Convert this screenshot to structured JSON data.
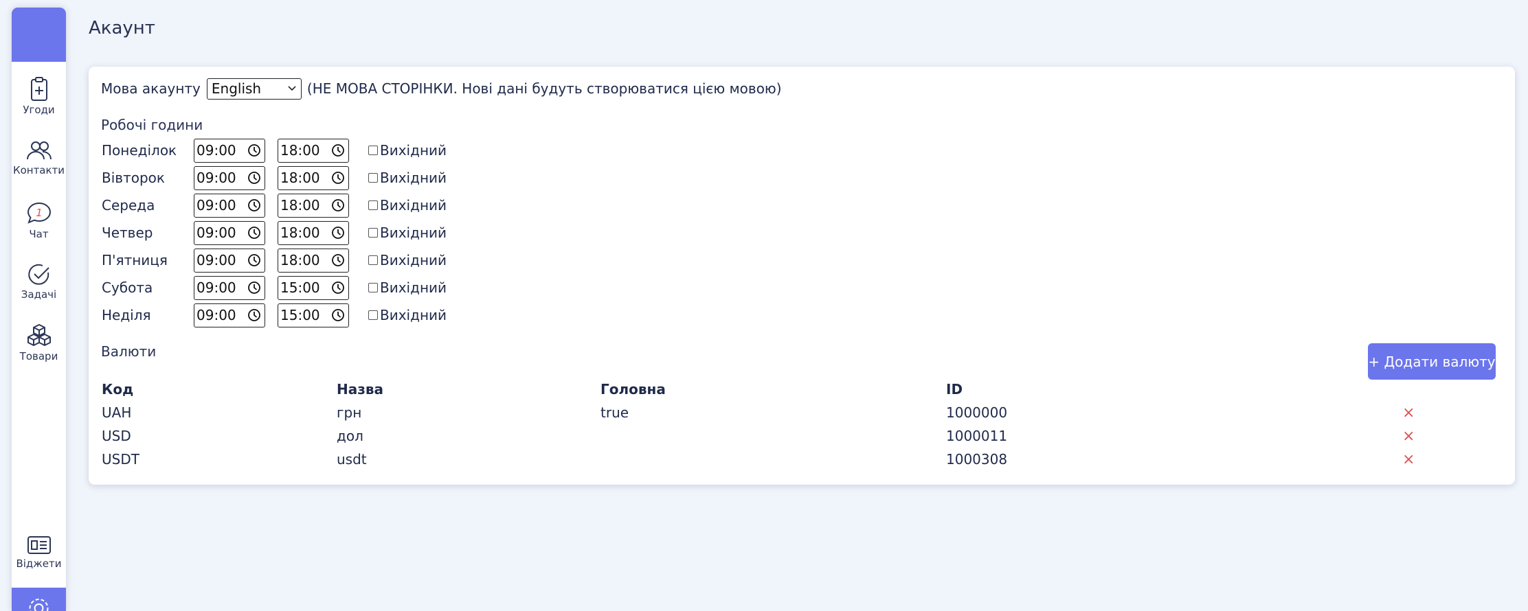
{
  "sidebar": {
    "items": [
      {
        "label": "Угоди",
        "icon": "clipboard-plus-icon"
      },
      {
        "label": "Контакти",
        "icon": "users-icon"
      },
      {
        "label": "Чат",
        "icon": "chat-icon",
        "badge": "1"
      },
      {
        "label": "Задачі",
        "icon": "check-circle-icon"
      },
      {
        "label": "Товари",
        "icon": "boxes-icon"
      }
    ],
    "widgets": {
      "label": "Віджети",
      "icon": "widgets-icon"
    },
    "settings": {
      "icon": "gear-icon"
    }
  },
  "page": {
    "title": "Акаунт"
  },
  "account_language": {
    "label": "Мова акаунту",
    "value": "English",
    "note": "(НЕ МОВА СТОРІНКИ. Нові дані будуть створюватися цією мовою)"
  },
  "working_hours": {
    "title": "Робочі години",
    "dayoff_label": "Вихідний",
    "days": [
      {
        "name": "Понеділок",
        "start": "09:00",
        "end": "18:00",
        "dayoff": false
      },
      {
        "name": "Вівторок",
        "start": "09:00",
        "end": "18:00",
        "dayoff": false
      },
      {
        "name": "Середа",
        "start": "09:00",
        "end": "18:00",
        "dayoff": false
      },
      {
        "name": "Четвер",
        "start": "09:00",
        "end": "18:00",
        "dayoff": false
      },
      {
        "name": "П'ятниця",
        "start": "09:00",
        "end": "18:00",
        "dayoff": false
      },
      {
        "name": "Субота",
        "start": "09:00",
        "end": "15:00",
        "dayoff": false
      },
      {
        "name": "Неділя",
        "start": "09:00",
        "end": "15:00",
        "dayoff": false
      }
    ]
  },
  "currencies": {
    "title": "Валюти",
    "add_button": "+ Додати валюту",
    "columns": [
      "Код",
      "Назва",
      "Головна",
      "ID"
    ],
    "rows": [
      {
        "code": "UAH",
        "name": "грн",
        "main": "true",
        "id": "1000000"
      },
      {
        "code": "USD",
        "name": "дол",
        "main": "",
        "id": "1000011"
      },
      {
        "code": "USDT",
        "name": "usdt",
        "main": "",
        "id": "1000308"
      }
    ],
    "delete_symbol": "×"
  },
  "colors": {
    "accent": "#6b75ec",
    "background": "#f0f4fb",
    "delete": "#e0524f"
  }
}
